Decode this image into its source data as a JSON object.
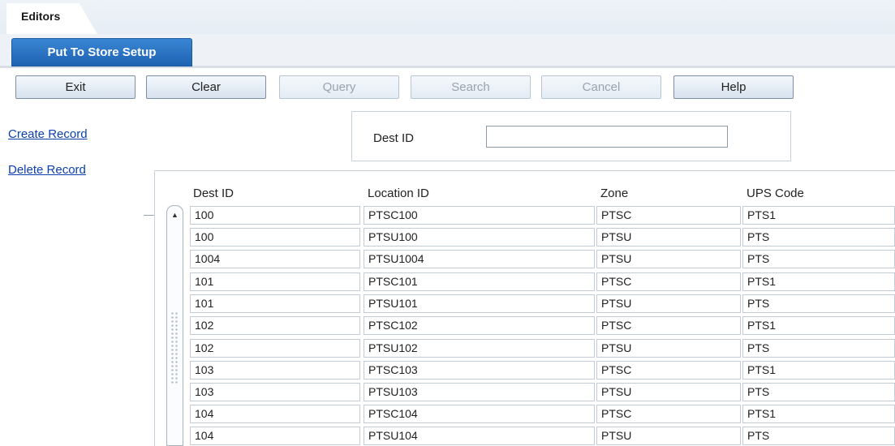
{
  "app": {
    "editors_tab": "Editors",
    "active_tab": "Put To Store Setup"
  },
  "toolbar": {
    "exit": "Exit",
    "clear": "Clear",
    "query": "Query",
    "search": "Search",
    "cancel": "Cancel",
    "help": "Help"
  },
  "actions": {
    "create_record": "Create Record",
    "delete_record": "Delete Record"
  },
  "query": {
    "dest_id_label": "Dest ID",
    "dest_id_value": ""
  },
  "table": {
    "columns": [
      "Dest ID",
      "Location ID",
      "Zone",
      "UPS Code"
    ],
    "rows": [
      [
        "100",
        "PTSC100",
        "PTSC",
        "PTS1"
      ],
      [
        "100",
        "PTSU100",
        "PTSU",
        "PTS"
      ],
      [
        "1004",
        "PTSU1004",
        "PTSU",
        "PTS"
      ],
      [
        "101",
        "PTSC101",
        "PTSC",
        "PTS1"
      ],
      [
        "101",
        "PTSU101",
        "PTSU",
        "PTS"
      ],
      [
        "102",
        "PTSC102",
        "PTSC",
        "PTS1"
      ],
      [
        "102",
        "PTSU102",
        "PTSU",
        "PTS"
      ],
      [
        "103",
        "PTSC103",
        "PTSC",
        "PTS1"
      ],
      [
        "103",
        "PTSU103",
        "PTSU",
        "PTS"
      ],
      [
        "104",
        "PTSC104",
        "PTSC",
        "PTS1"
      ],
      [
        "104",
        "PTSU104",
        "PTSU",
        "PTS"
      ]
    ]
  },
  "icons": {
    "scroll_up": "scroll-up-arrow-icon"
  }
}
